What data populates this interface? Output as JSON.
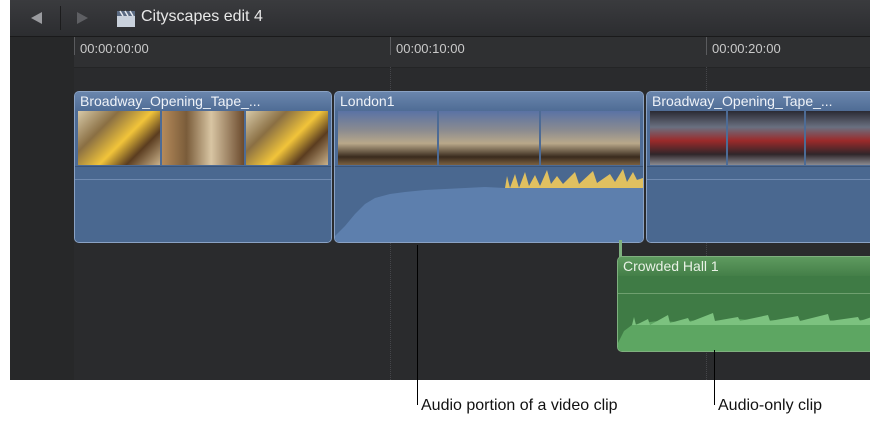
{
  "titlebar": {
    "project_title": "Cityscapes edit 4"
  },
  "ruler": {
    "timecodes": [
      "00:00:00:00",
      "00:00:10:00",
      "00:00:20:00"
    ]
  },
  "timeline": {
    "video_clips": [
      {
        "name": "Broadway_Opening_Tape_..."
      },
      {
        "name": "London1"
      },
      {
        "name": "Broadway_Opening_Tape_..."
      }
    ],
    "audio_clips": [
      {
        "name": "Crowded Hall 1"
      }
    ]
  },
  "callouts": {
    "audio_portion": "Audio portion of a video clip",
    "audio_only": "Audio-only clip"
  },
  "colors": {
    "video_clip": "#4d6b95",
    "audio_clip": "#3f7b45",
    "waveform_peak": "#e0c060"
  }
}
